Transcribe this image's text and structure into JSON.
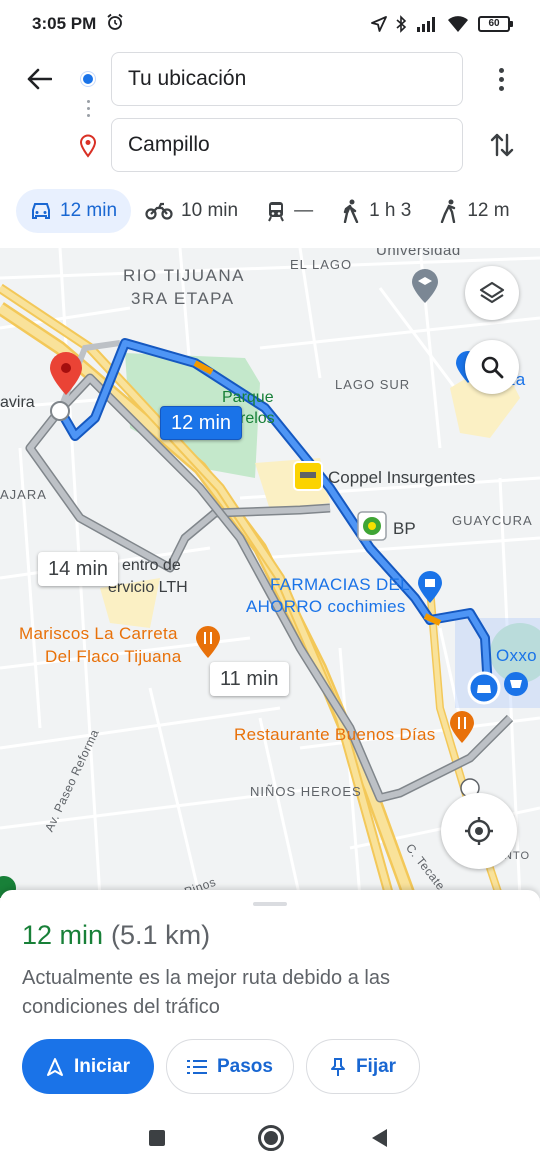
{
  "status_bar": {
    "time": "3:05 PM",
    "battery": "60",
    "icons": [
      "alarm-icon",
      "location-arrow-icon",
      "bluetooth-icon",
      "signal-icon",
      "wifi-icon",
      "battery-icon"
    ]
  },
  "directions": {
    "origin": "Tu ubicación",
    "destination": "Campillo"
  },
  "modes": [
    {
      "icon": "car-icon",
      "label": "12 min",
      "active": true
    },
    {
      "icon": "motorcycle-icon",
      "label": "10 min",
      "active": false
    },
    {
      "icon": "transit-icon",
      "label": "—",
      "active": false
    },
    {
      "icon": "walk-icon",
      "label": "1 h 3",
      "active": false
    },
    {
      "icon": "bike-icon",
      "label": "12 m",
      "active": false
    }
  ],
  "map": {
    "labels": {
      "area1": "RIO TIJUANA",
      "area2": "3RA ETAPA",
      "el_lago": "EL LAGO",
      "universidad": "Universidad",
      "lago_sur": "LAGO SUR",
      "za": "za",
      "parque1": "Parque",
      "parque2": "relos",
      "avira": "avira",
      "coppel": "Coppel Insurgentes",
      "guaycura": "GUAYCURA",
      "bp": "BP",
      "ajara": "AJARA",
      "servicio1": "entro de",
      "servicio2": "ervicio LTH",
      "farmacias1": "FARMACIAS DEL",
      "farmacias2": "AHORRO cochimies",
      "oxxo": "Oxxo",
      "mariscos1": "Mariscos La Carreta",
      "mariscos2": "Del Flaco Tijuana",
      "restaurante": "Restaurante Buenos Días",
      "ninos": "NIÑOS HEROES",
      "reforma": "Av. Paseo Reforma",
      "pinos": "Los Pinos",
      "tecate": "C. Tecate",
      "nto": "NTO"
    },
    "route_labels": {
      "primary": "12 min",
      "alt1": "14 min",
      "alt2": "11 min"
    },
    "colors": {
      "route_primary": "#1a73e8",
      "route_alt": "#9aa0a6",
      "traffic_slow": "#f29900",
      "park": "#c4e8cb",
      "highway": "#f7d676",
      "destination_pin": "#ea4335"
    }
  },
  "summary": {
    "duration": "12 min",
    "distance": "(5.1 km)",
    "description": "Actualmente es la mejor ruta debido a las condiciones del tráfico"
  },
  "actions": {
    "start": "Iniciar",
    "steps": "Pasos",
    "pin": "Fijar"
  }
}
